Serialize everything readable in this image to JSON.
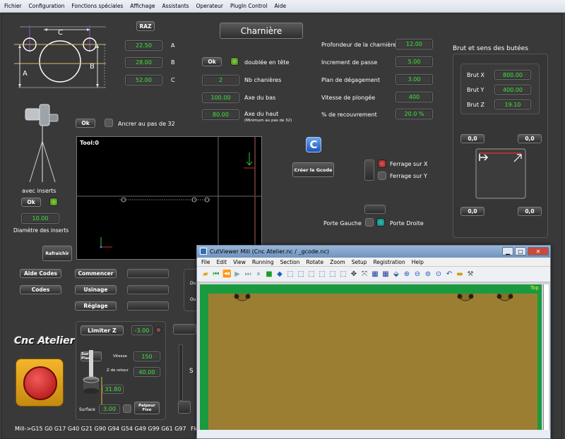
{
  "menu": [
    "Fichier",
    "Configuration",
    "Fonctions spéciales",
    "Affichage",
    "Assistants",
    "Operateur",
    "PlugIn Control",
    "Aide"
  ],
  "diagram": {
    "a": "A",
    "b": "B",
    "c": "C"
  },
  "raz": "RAZ",
  "title": "Charnière",
  "dims": {
    "a": {
      "value": "22.50",
      "label": "A"
    },
    "b": {
      "value": "28.00",
      "label": "B"
    },
    "c": {
      "value": "52.00",
      "label": "C"
    }
  },
  "ok": "Ok",
  "doublee": "doublée en tête",
  "nb_charnieres": {
    "value": "2",
    "label": "Nb chanières"
  },
  "axe_bas": {
    "value": "100.00",
    "label": "Axe du bas"
  },
  "axe_haut": {
    "value": "80.00",
    "label": "Axe du haut",
    "note": "(Minimum au pas de 32)"
  },
  "ancrer": "Ancrer au pas de 32",
  "params": {
    "profondeur": {
      "label": "Profondeur de la charnière",
      "value": "12.00"
    },
    "increment": {
      "label": "Increment de passe",
      "value": "5.00"
    },
    "degagement": {
      "label": "Plan de dégagement",
      "value": "3.00"
    },
    "vitesse": {
      "label": "Vitesse de plongée",
      "value": "400"
    },
    "recouvrement": {
      "label": "% de recouvrement",
      "value": "20.0 %"
    }
  },
  "brut": {
    "title": "Brut et sens des butées",
    "x": {
      "label": "Brut X",
      "value": "800.00"
    },
    "y": {
      "label": "Brut Y",
      "value": "400.00"
    },
    "z": {
      "label": "Brut Z",
      "value": "19.10"
    },
    "corners": [
      "0,0",
      "0,0",
      "0,0",
      "0,0"
    ]
  },
  "viewer": {
    "label": "Tool:0"
  },
  "creer_gcode": "Créer le Gcode",
  "ferrage_x": "Ferrage sur X",
  "ferrage_y": "Ferrage sur Y",
  "porte_gauche": "Porte Gauche",
  "porte_droite": "Porte Droite",
  "avec_inserts": "avec inserts",
  "diametre": {
    "value": "10.00",
    "label": "Diamètre des inserts"
  },
  "rafraichir": "Rafraichir",
  "buttons": {
    "aide_codes": "Aide Codes",
    "codes": "Codes",
    "commencer": "Commencer",
    "usinage": "Usinage",
    "reglage": "Réglage"
  },
  "side_labels": {
    "du": "Du",
    "ou": "Ou",
    "s": "S"
  },
  "limiter_z": {
    "label": "Limiter Z",
    "value": "-3.00"
  },
  "probe": {
    "sur_place": "Sur Place",
    "vitesse": {
      "label": "Vitesse",
      "value": "150"
    },
    "retour": {
      "label": "Z de retour",
      "value": "40.00"
    },
    "height": "31.80",
    "surface": {
      "label": "Surface",
      "value": "3.00"
    },
    "palpeur": "Palpeur Fixe"
  },
  "logo": "Cnc Atelier",
  "status": "Mill->G15  G0 G17 G40 G21 G90 G94 G54 G49 G99 G61 G97",
  "status_tail": "Fk",
  "cutviewer": {
    "title": "CutViewer Mill (Cnc Atelier.nc / _gcode.nc)",
    "menu": [
      "File",
      "Edit",
      "View",
      "Running",
      "Section",
      "Rotate",
      "Zoom",
      "Setup",
      "Registration",
      "Help"
    ],
    "top_label": "Top"
  },
  "colors": {
    "field_text": "#37e637",
    "wood": "#9c7e33",
    "stock_green": "#1a9a3e"
  }
}
